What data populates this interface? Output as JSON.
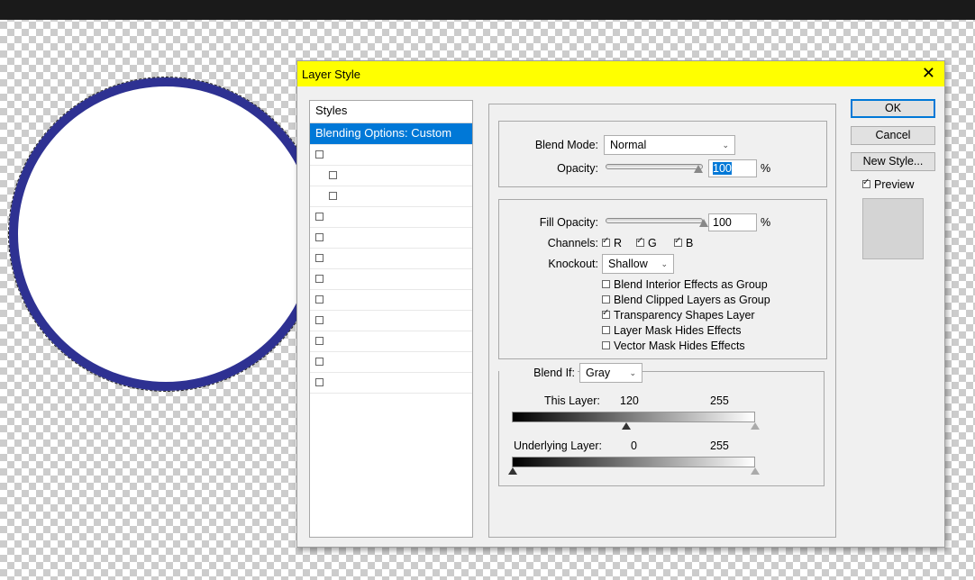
{
  "dialog": {
    "title": "Layer Style",
    "close_glyph": "✕"
  },
  "styles_list": {
    "header": "Styles",
    "selected_item": "Blending Options: Custom",
    "unlabeled_rows": 12
  },
  "general_blending": {
    "blend_mode_label": "Blend Mode:",
    "blend_mode_value": "Normal",
    "opacity_label": "Opacity:",
    "opacity_value": "100",
    "percent": "%"
  },
  "advanced_blending": {
    "fill_opacity_label": "Fill Opacity:",
    "fill_opacity_value": "100",
    "percent": "%",
    "channels_label": "Channels:",
    "channels": [
      {
        "name": "R",
        "checked": true
      },
      {
        "name": "G",
        "checked": true
      },
      {
        "name": "B",
        "checked": true
      }
    ],
    "knockout_label": "Knockout:",
    "knockout_value": "Shallow",
    "options": [
      {
        "label": "Blend Interior Effects as Group",
        "checked": false
      },
      {
        "label": "Blend Clipped Layers as Group",
        "checked": false
      },
      {
        "label": "Transparency Shapes Layer",
        "checked": true
      },
      {
        "label": "Layer Mask Hides Effects",
        "checked": false
      },
      {
        "label": "Vector Mask Hides Effects",
        "checked": false
      }
    ]
  },
  "blend_if": {
    "label": "Blend If:",
    "value": "Gray",
    "this_layer_label": "This Layer:",
    "this_layer_low": "120",
    "this_layer_high": "255",
    "underlying_label": "Underlying Layer:",
    "underlying_low": "0",
    "underlying_high": "255"
  },
  "buttons": {
    "ok": "OK",
    "cancel": "Cancel",
    "new_style": "New Style...",
    "preview_label": "Preview",
    "preview_checked": true
  },
  "colors": {
    "title_bar": "#ffff00",
    "selection": "#0078d7",
    "circle_stroke": "#2e3192"
  }
}
